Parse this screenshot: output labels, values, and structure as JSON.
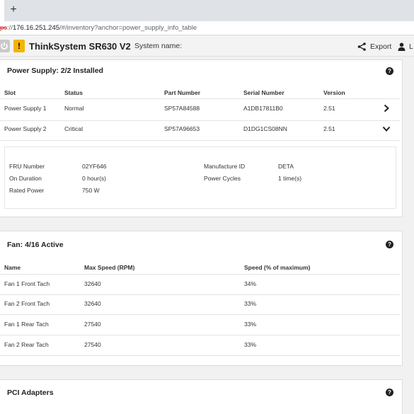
{
  "browser": {
    "new_tab": "+",
    "url_scheme": "ps",
    "url_rest": "://",
    "url_host": "176.16.251.245",
    "url_path": "/#/inventory?anchor=power_supply_info_table"
  },
  "header": {
    "warning_symbol": "!",
    "product_name": "ThinkSystem SR630 V2",
    "system_name_label": "System name:",
    "system_name_value": "",
    "export_label": "Export",
    "user_label": "L"
  },
  "power_supply": {
    "title": "Power Supply: 2/2 Installed",
    "columns": [
      "Slot",
      "Status",
      "Part Number",
      "Serial Number",
      "Version"
    ],
    "rows": [
      {
        "slot": "Power Supply 1",
        "status": "Normal",
        "part_number": "SP57A84588",
        "serial_number": "A1DB17811B0",
        "version": "2.51",
        "expanded": false
      },
      {
        "slot": "Power Supply 2",
        "status": "Critical",
        "part_number": "SP57A96653",
        "serial_number": "D1DG1CS08NN",
        "version": "2.51",
        "expanded": true
      }
    ],
    "details": {
      "fru_label": "FRU Number",
      "fru_value": "02YF646",
      "duration_label": "On Duration",
      "duration_value": "0 hour(s)",
      "rated_label": "Rated Power",
      "rated_value": "750 W",
      "mfg_label": "Manufacture ID",
      "mfg_value": "DETA",
      "cycles_label": "Power Cycles",
      "cycles_value": "1 time(s)"
    }
  },
  "fans": {
    "title": "Fan: 4/16 Active",
    "columns": [
      "Name",
      "Max Speed (RPM)",
      "Speed (% of maximum)"
    ],
    "rows": [
      {
        "name": "Fan 1 Front Tach",
        "max_speed": "32640",
        "speed": "34%"
      },
      {
        "name": "Fan 2 Front Tach",
        "max_speed": "32640",
        "speed": "33%"
      },
      {
        "name": "Fan 1 Rear Tach",
        "max_speed": "27540",
        "speed": "33%"
      },
      {
        "name": "Fan 2 Rear Tach",
        "max_speed": "27540",
        "speed": "33%"
      }
    ]
  },
  "pci": {
    "title": "PCI Adapters"
  },
  "colors": {
    "warning": "#f4b400",
    "url_insecure": "#c5221f"
  },
  "icons": [
    "power-icon",
    "warning-icon",
    "share-icon",
    "user-icon",
    "help-icon",
    "chevron-right-icon",
    "chevron-down-icon"
  ]
}
